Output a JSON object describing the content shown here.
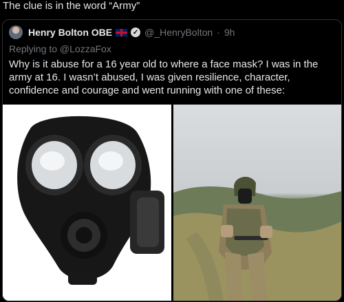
{
  "caption": "The clue is in the word “Army”",
  "tweet": {
    "author_name": "Henry Bolton OBE",
    "handle": "@_HenryBolton",
    "separator": "·",
    "time": "9h",
    "replying_to": "Replying to @LozzaFox",
    "text": "Why is it abuse for a 16 year old to where a face mask? I was in the army at 16. I wasn’t abused, I was given resilience, character, confidence and courage and went running with one of these:",
    "icons": [
      "avatar",
      "uk-flag-icon",
      "verified-badge-icon"
    ],
    "media": [
      "gas-mask-photo",
      "soldier-photo"
    ]
  },
  "colors": {
    "background": "#000000",
    "text": "#e7e9ea",
    "muted": "#71767b",
    "border": "#2f3336"
  }
}
